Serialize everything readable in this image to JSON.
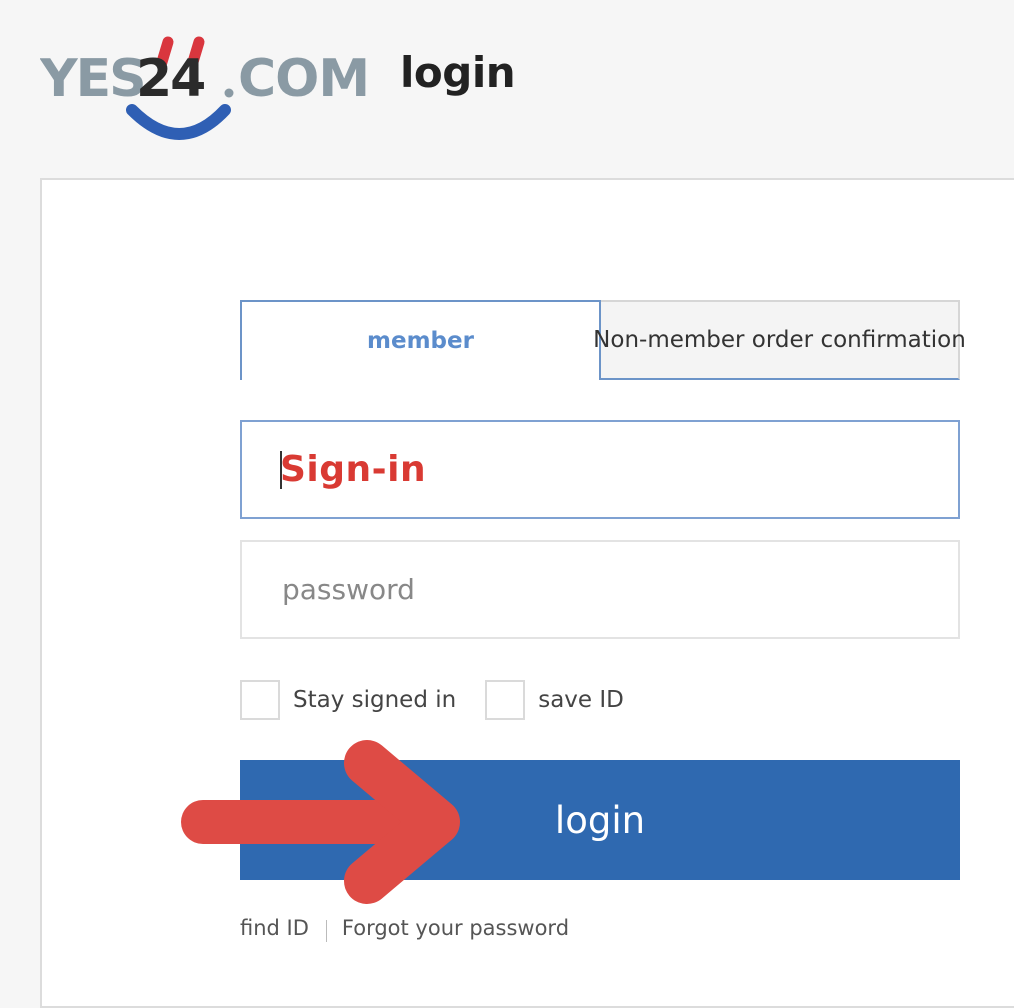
{
  "header": {
    "logo_text": "YES24.COM",
    "title": "login"
  },
  "tabs": [
    {
      "label": "member",
      "active": true
    },
    {
      "label": "Non-member order confirmation",
      "active": false
    }
  ],
  "form": {
    "id_value": "Sign-in",
    "password_placeholder": "password",
    "stay_signed_in_label": "Stay signed in",
    "save_id_label": "save ID",
    "login_label": "login"
  },
  "links": {
    "find_id": "find ID",
    "forgot_password": "Forgot your password"
  },
  "colors": {
    "accent": "#2f69b0",
    "active_tab_text": "#5b8ccc",
    "annotation": "#de4b45",
    "id_text": "#d93a33"
  },
  "icons": {
    "logo": "yes24-logo",
    "annotation": "arrow-right-icon"
  }
}
